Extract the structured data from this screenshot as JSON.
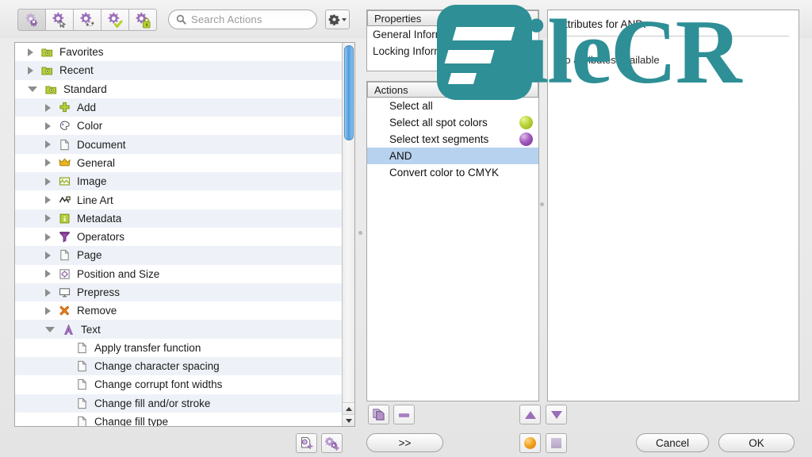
{
  "toolbar": {
    "buttons": [
      {
        "name": "new-action-list-button",
        "icon": "gear-icon",
        "pressed": true
      },
      {
        "name": "edit-action-button",
        "icon": "gear-cursor-icon",
        "pressed": false
      },
      {
        "name": "refresh-action-button",
        "icon": "gear-refresh-icon",
        "pressed": false
      },
      {
        "name": "validate-action-button",
        "icon": "gear-check-icon",
        "pressed": false
      },
      {
        "name": "lock-action-button",
        "icon": "gear-lock-icon",
        "pressed": false
      }
    ],
    "search": {
      "placeholder": "Search Actions",
      "value": "",
      "icon": "search-icon"
    },
    "gear_menu": {
      "icon": "gear-icon",
      "label": ""
    }
  },
  "tree": {
    "rows": [
      {
        "label": "Favorites",
        "depth": 0,
        "twisty": "closed",
        "icon": "folder-green-icon"
      },
      {
        "label": "Recent",
        "depth": 0,
        "twisty": "closed",
        "icon": "folder-green-icon"
      },
      {
        "label": "Standard",
        "depth": 0,
        "twisty": "open",
        "icon": "folder-green-icon"
      },
      {
        "label": "Add",
        "depth": 1,
        "twisty": "closed",
        "icon": "plus-green-icon"
      },
      {
        "label": "Color",
        "depth": 1,
        "twisty": "closed",
        "icon": "palette-icon"
      },
      {
        "label": "Document",
        "depth": 1,
        "twisty": "closed",
        "icon": "document-icon"
      },
      {
        "label": "General",
        "depth": 1,
        "twisty": "closed",
        "icon": "crown-icon"
      },
      {
        "label": "Image",
        "depth": 1,
        "twisty": "closed",
        "icon": "image-icon"
      },
      {
        "label": "Line Art",
        "depth": 1,
        "twisty": "closed",
        "icon": "line-art-icon"
      },
      {
        "label": "Metadata",
        "depth": 1,
        "twisty": "closed",
        "icon": "info-green-icon"
      },
      {
        "label": "Operators",
        "depth": 1,
        "twisty": "closed",
        "icon": "operators-icon"
      },
      {
        "label": "Page",
        "depth": 1,
        "twisty": "closed",
        "icon": "page-icon"
      },
      {
        "label": "Position and Size",
        "depth": 1,
        "twisty": "closed",
        "icon": "position-size-icon"
      },
      {
        "label": "Prepress",
        "depth": 1,
        "twisty": "closed",
        "icon": "monitor-icon"
      },
      {
        "label": "Remove",
        "depth": 1,
        "twisty": "closed",
        "icon": "remove-x-icon"
      },
      {
        "label": "Text",
        "depth": 1,
        "twisty": "open",
        "icon": "text-a-icon"
      },
      {
        "label": "Apply transfer function",
        "depth": 2,
        "twisty": "none",
        "icon": "document-icon"
      },
      {
        "label": "Change character spacing",
        "depth": 2,
        "twisty": "none",
        "icon": "document-icon"
      },
      {
        "label": "Change corrupt font widths",
        "depth": 2,
        "twisty": "none",
        "icon": "document-icon"
      },
      {
        "label": "Change fill and/or stroke",
        "depth": 2,
        "twisty": "none",
        "icon": "document-icon"
      },
      {
        "label": "Change fill type",
        "depth": 2,
        "twisty": "none",
        "icon": "document-icon"
      }
    ]
  },
  "properties": {
    "header": "Properties",
    "items": [
      "General Information",
      "Locking Information"
    ]
  },
  "actions": {
    "header": "Actions",
    "items": [
      {
        "label": "Select all",
        "selected": false,
        "marker": ""
      },
      {
        "label": "Select all spot colors",
        "selected": false,
        "marker": "green"
      },
      {
        "label": "Select text segments",
        "selected": false,
        "marker": "purple"
      },
      {
        "label": "AND",
        "selected": true,
        "marker": ""
      },
      {
        "label": "Convert color to CMYK",
        "selected": false,
        "marker": ""
      }
    ]
  },
  "attributes": {
    "title": "Attributes for AND:",
    "empty_message": "No attributes available"
  },
  "bottom": {
    "duplicate_button": {
      "name": "duplicate-action-button",
      "icon": "duplicate-icon"
    },
    "remove_button": {
      "name": "remove-action-button",
      "icon": "minus-icon"
    },
    "expand_button": {
      "label": ">>"
    },
    "move_up_button": {
      "name": "move-up-button",
      "icon": "triangle-up-icon"
    },
    "move_down_button": {
      "name": "move-down-button",
      "icon": "triangle-down-icon"
    },
    "run_button": {
      "name": "run-button",
      "icon": "orange-sphere-icon"
    },
    "stop_button": {
      "name": "stop-button",
      "icon": "stop-square-icon"
    },
    "new_action_button": {
      "name": "new-action-button",
      "icon": "page-gear-plus-icon"
    },
    "new_action_list_button": {
      "name": "new-action-list-button",
      "icon": "gears-plus-icon"
    },
    "cancel_button": {
      "label": "Cancel"
    },
    "ok_button": {
      "label": "OK"
    }
  },
  "watermark": {
    "text": "ileCR",
    "color": "#2e8f96"
  },
  "colors": {
    "selection": "#b6d2ee",
    "stripe": "#eef2f8",
    "scrollbar_thumb": "#4d9ede",
    "gear_purple": "#9b6fb8",
    "folder_green": "#a9c83c"
  }
}
